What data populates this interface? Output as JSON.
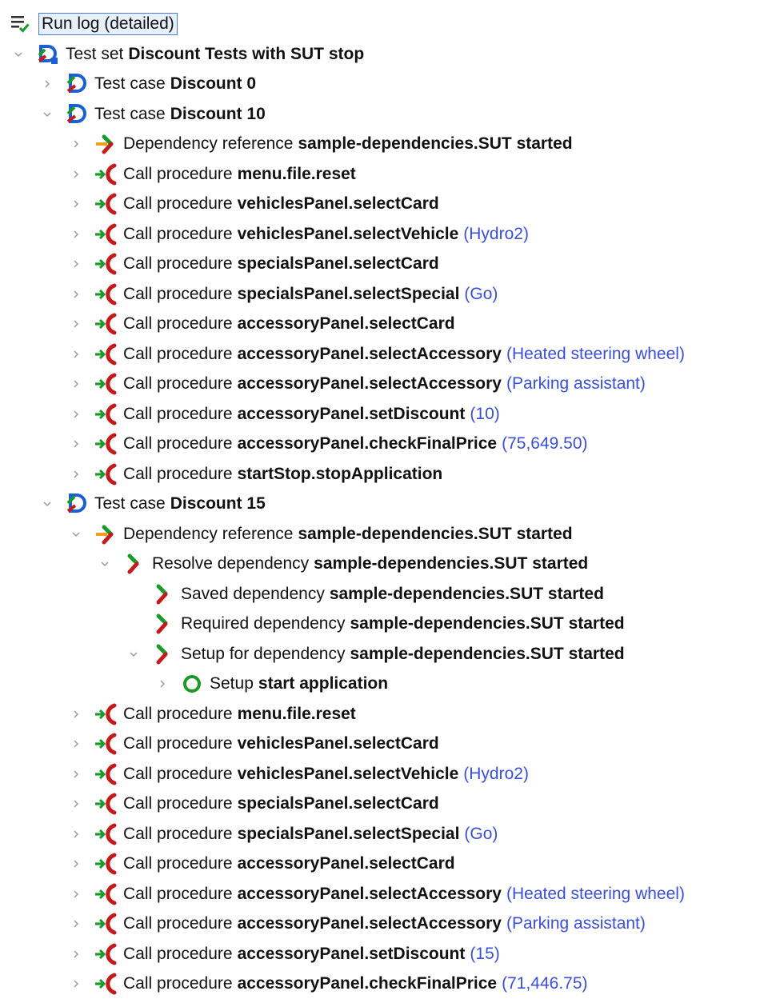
{
  "root": {
    "label": "Run log (detailed)",
    "icon": "run-log-icon"
  },
  "colors": {
    "param": "#3a4fd6",
    "green": "#1a9a2a",
    "red": "#c41a1a",
    "orange": "#e8a21a",
    "blue": "#1b5fd1"
  },
  "rows": [
    {
      "depth": 1,
      "exp": "open",
      "icon": "testset",
      "prefix": "Test set",
      "name": "Discount Tests with SUT stop",
      "param": ""
    },
    {
      "depth": 2,
      "exp": "closed",
      "icon": "testcase",
      "prefix": "Test case",
      "name": "Discount 0",
      "param": ""
    },
    {
      "depth": 2,
      "exp": "open",
      "icon": "testcase",
      "prefix": "Test case",
      "name": "Discount 10",
      "param": ""
    },
    {
      "depth": 3,
      "exp": "closed",
      "icon": "depref",
      "prefix": "Dependency reference",
      "name": "sample-dependencies.SUT started",
      "param": ""
    },
    {
      "depth": 3,
      "exp": "closed",
      "icon": "call",
      "prefix": "Call procedure",
      "name": "menu.file.reset",
      "param": ""
    },
    {
      "depth": 3,
      "exp": "closed",
      "icon": "call",
      "prefix": "Call procedure",
      "name": "vehiclesPanel.selectCard",
      "param": ""
    },
    {
      "depth": 3,
      "exp": "closed",
      "icon": "call",
      "prefix": "Call procedure",
      "name": "vehiclesPanel.selectVehicle",
      "param": "(Hydro2)"
    },
    {
      "depth": 3,
      "exp": "closed",
      "icon": "call",
      "prefix": "Call procedure",
      "name": "specialsPanel.selectCard",
      "param": ""
    },
    {
      "depth": 3,
      "exp": "closed",
      "icon": "call",
      "prefix": "Call procedure",
      "name": "specialsPanel.selectSpecial",
      "param": "(Go)"
    },
    {
      "depth": 3,
      "exp": "closed",
      "icon": "call",
      "prefix": "Call procedure",
      "name": "accessoryPanel.selectCard",
      "param": ""
    },
    {
      "depth": 3,
      "exp": "closed",
      "icon": "call",
      "prefix": "Call procedure",
      "name": "accessoryPanel.selectAccessory",
      "param": "(Heated steering wheel)"
    },
    {
      "depth": 3,
      "exp": "closed",
      "icon": "call",
      "prefix": "Call procedure",
      "name": "accessoryPanel.selectAccessory",
      "param": "(Parking assistant)"
    },
    {
      "depth": 3,
      "exp": "closed",
      "icon": "call",
      "prefix": "Call procedure",
      "name": "accessoryPanel.setDiscount",
      "param": "(10)"
    },
    {
      "depth": 3,
      "exp": "closed",
      "icon": "call",
      "prefix": "Call procedure",
      "name": "accessoryPanel.checkFinalPrice",
      "param": "(75,649.50)"
    },
    {
      "depth": 3,
      "exp": "closed",
      "icon": "call",
      "prefix": "Call procedure",
      "name": "startStop.stopApplication",
      "param": ""
    },
    {
      "depth": 2,
      "exp": "open",
      "icon": "testcase",
      "prefix": "Test case",
      "name": "Discount 15",
      "param": ""
    },
    {
      "depth": 3,
      "exp": "open",
      "icon": "depref",
      "prefix": "Dependency reference",
      "name": "sample-dependencies.SUT started",
      "param": ""
    },
    {
      "depth": 4,
      "exp": "open",
      "icon": "dep",
      "prefix": "Resolve dependency",
      "name": "sample-dependencies.SUT started",
      "param": ""
    },
    {
      "depth": 5,
      "exp": "none",
      "icon": "dep",
      "prefix": "Saved dependency",
      "name": "sample-dependencies.SUT started",
      "param": ""
    },
    {
      "depth": 5,
      "exp": "none",
      "icon": "dep",
      "prefix": "Required dependency",
      "name": "sample-dependencies.SUT started",
      "param": ""
    },
    {
      "depth": 5,
      "exp": "open",
      "icon": "dep",
      "prefix": "Setup for dependency",
      "name": "sample-dependencies.SUT started",
      "param": ""
    },
    {
      "depth": 6,
      "exp": "closed",
      "icon": "setup",
      "prefix": "Setup",
      "name": "start application",
      "param": ""
    },
    {
      "depth": 3,
      "exp": "closed",
      "icon": "call",
      "prefix": "Call procedure",
      "name": "menu.file.reset",
      "param": ""
    },
    {
      "depth": 3,
      "exp": "closed",
      "icon": "call",
      "prefix": "Call procedure",
      "name": "vehiclesPanel.selectCard",
      "param": ""
    },
    {
      "depth": 3,
      "exp": "closed",
      "icon": "call",
      "prefix": "Call procedure",
      "name": "vehiclesPanel.selectVehicle",
      "param": "(Hydro2)"
    },
    {
      "depth": 3,
      "exp": "closed",
      "icon": "call",
      "prefix": "Call procedure",
      "name": "specialsPanel.selectCard",
      "param": ""
    },
    {
      "depth": 3,
      "exp": "closed",
      "icon": "call",
      "prefix": "Call procedure",
      "name": "specialsPanel.selectSpecial",
      "param": "(Go)"
    },
    {
      "depth": 3,
      "exp": "closed",
      "icon": "call",
      "prefix": "Call procedure",
      "name": "accessoryPanel.selectCard",
      "param": ""
    },
    {
      "depth": 3,
      "exp": "closed",
      "icon": "call",
      "prefix": "Call procedure",
      "name": "accessoryPanel.selectAccessory",
      "param": "(Heated steering wheel)"
    },
    {
      "depth": 3,
      "exp": "closed",
      "icon": "call",
      "prefix": "Call procedure",
      "name": "accessoryPanel.selectAccessory",
      "param": "(Parking assistant)"
    },
    {
      "depth": 3,
      "exp": "closed",
      "icon": "call",
      "prefix": "Call procedure",
      "name": "accessoryPanel.setDiscount",
      "param": "(15)"
    },
    {
      "depth": 3,
      "exp": "closed",
      "icon": "call",
      "prefix": "Call procedure",
      "name": "accessoryPanel.checkFinalPrice",
      "param": "(71,446.75)"
    }
  ]
}
